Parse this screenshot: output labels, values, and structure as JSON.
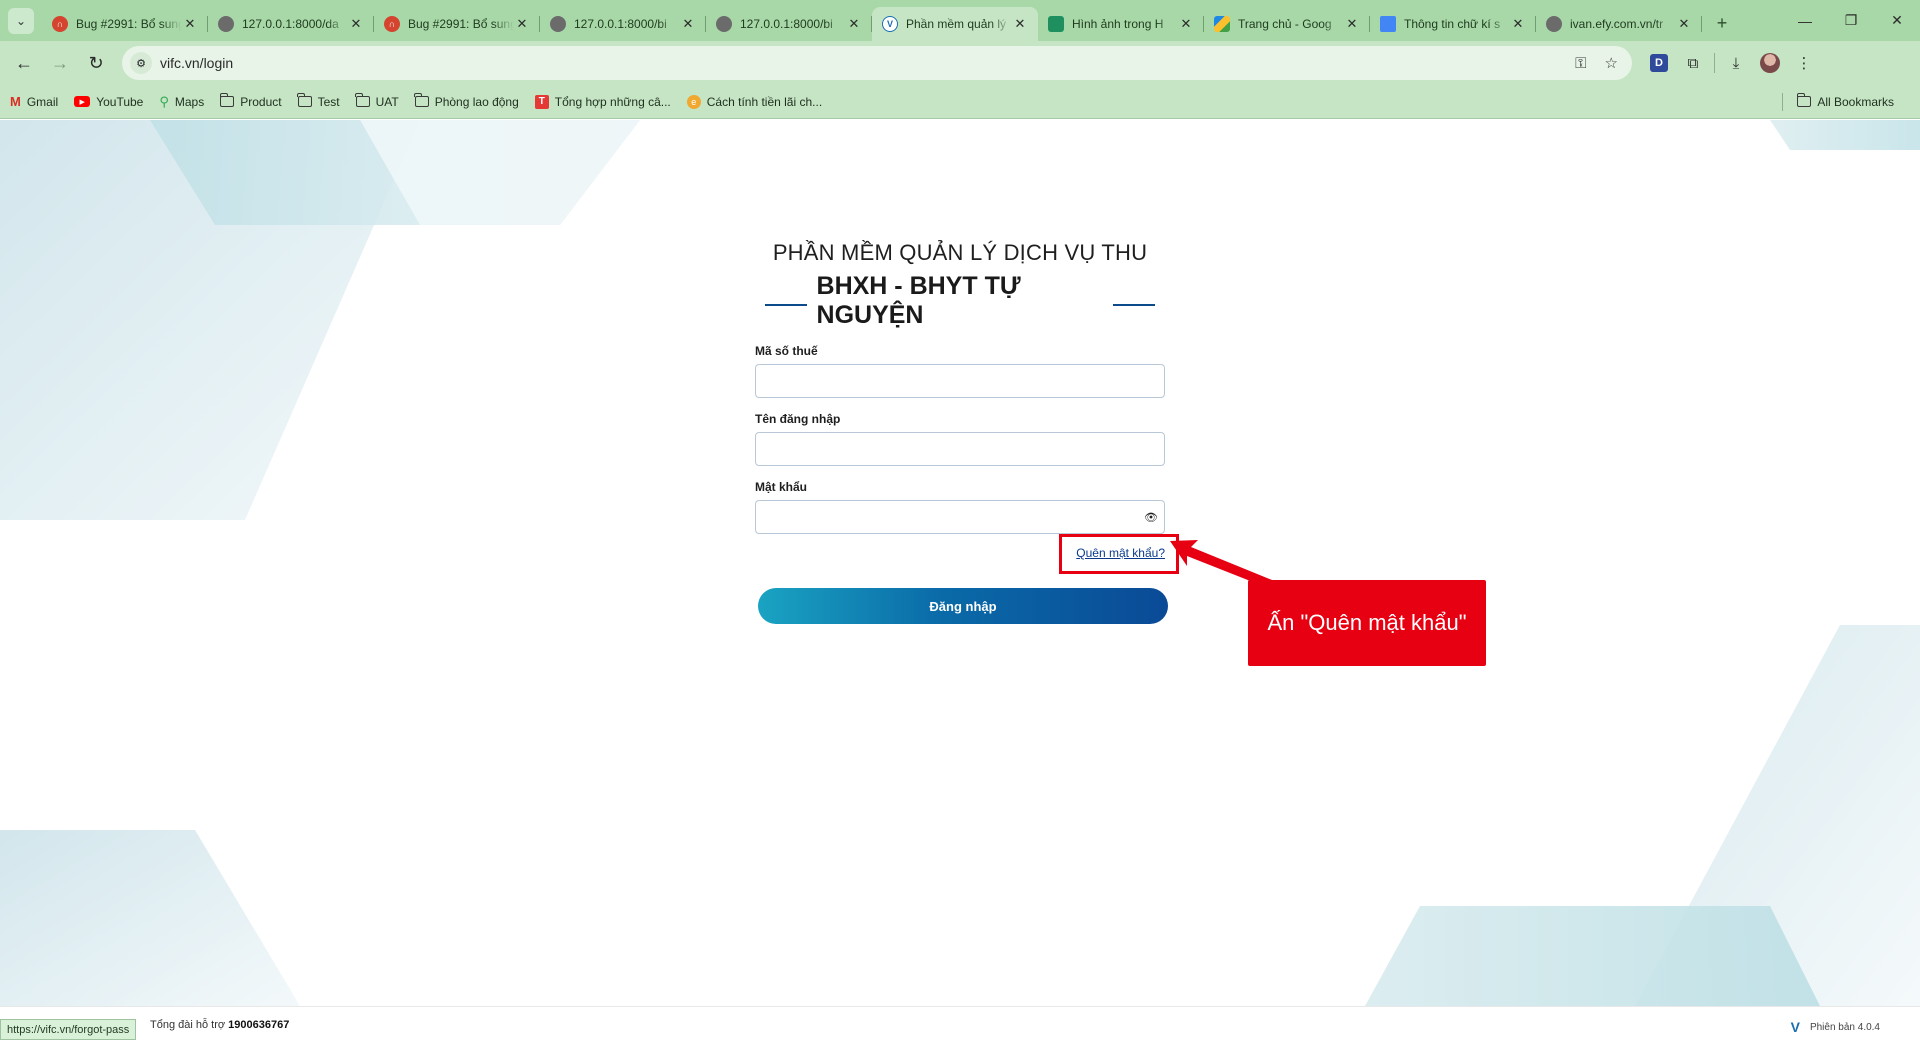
{
  "browser": {
    "tabs": [
      {
        "title": "Bug #2991: Bổ sung",
        "icon": "redmine-icon"
      },
      {
        "title": "127.0.0.1:8000/da",
        "icon": "globe-icon"
      },
      {
        "title": "Bug #2991: Bổ sung",
        "icon": "redmine-icon"
      },
      {
        "title": "127.0.0.1:8000/bi",
        "icon": "globe-icon"
      },
      {
        "title": "127.0.0.1:8000/bi",
        "icon": "globe-icon"
      },
      {
        "title": "Phần mềm quản lý",
        "icon": "vifc-icon",
        "active": true
      },
      {
        "title": "Hình ảnh trong H",
        "icon": "image-icon"
      },
      {
        "title": "Trang chủ - Goog",
        "icon": "google-drive-icon"
      },
      {
        "title": "Thông tin chữ kí s",
        "icon": "docs-icon"
      },
      {
        "title": "ivan.efy.com.vn/tr",
        "icon": "globe-icon"
      }
    ],
    "url": "vifc.vn/login",
    "bookmarks": [
      {
        "label": "Gmail",
        "icon": "gmail-icon"
      },
      {
        "label": "YouTube",
        "icon": "youtube-icon"
      },
      {
        "label": "Maps",
        "icon": "maps-icon"
      },
      {
        "label": "Product",
        "icon": "folder-icon"
      },
      {
        "label": "Test",
        "icon": "folder-icon"
      },
      {
        "label": "UAT",
        "icon": "folder-icon"
      },
      {
        "label": "Phòng lao động",
        "icon": "folder-icon"
      },
      {
        "label": "Tổng hợp những câ...",
        "icon": "t-icon"
      },
      {
        "label": "Cách tính tiền lãi ch...",
        "icon": "coin-icon"
      }
    ],
    "all_bookmarks": "All Bookmarks",
    "status_url": "https://vifc.vn/forgot-pass"
  },
  "login": {
    "title_line1": "PHẦN MỀM QUẢN LÝ DỊCH VỤ THU",
    "title_line2": "BHXH - BHYT TỰ NGUYỆN",
    "tax_code_label": "Mã số thuế",
    "tax_code_value": "",
    "username_label": "Tên đăng nhập",
    "username_value": "",
    "password_label": "Mật khẩu",
    "password_value": "",
    "forgot_password": "Quên mật khẩu?",
    "login_button": "Đăng nhập"
  },
  "annotation": {
    "callout_text": "Ấn \"Quên mật khẩu\"",
    "color": "#e60012"
  },
  "footer": {
    "support_label": "Tổng đài hỗ trợ",
    "support_phone": "1900636767",
    "version": "Phiên bản 4.0.4"
  },
  "colors": {
    "chrome": "#c5e5c5",
    "accent": "#0a4a96"
  }
}
